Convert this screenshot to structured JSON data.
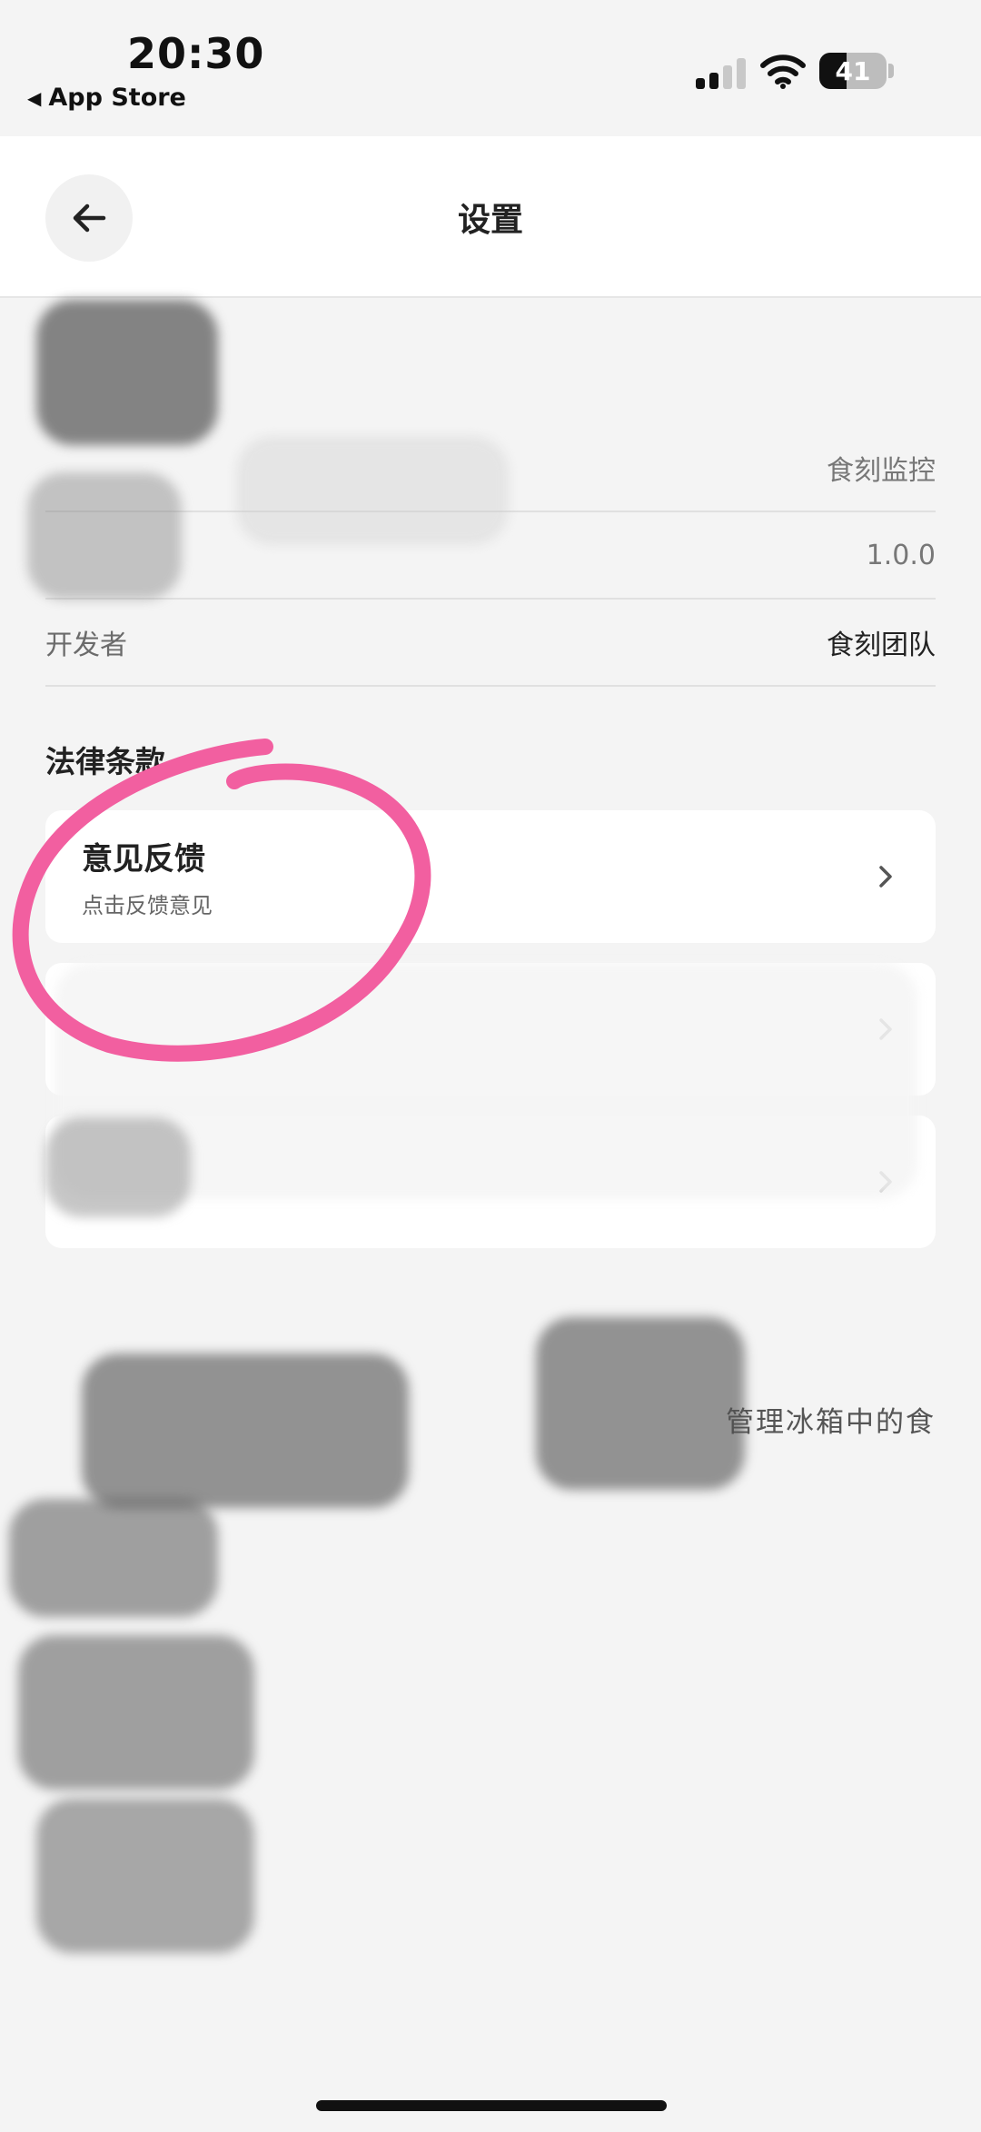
{
  "status_bar": {
    "time": "20:30",
    "back_app": "App Store",
    "battery": "41",
    "battery_level": 0.41,
    "icons": [
      "signal-icon",
      "wifi-icon",
      "battery-icon"
    ]
  },
  "header": {
    "title": "设置",
    "back_icon": "arrow-left-icon"
  },
  "info": {
    "app_name_value": "食刻监控",
    "version_value": "1.0.0",
    "developer_label": "开发者",
    "developer_value": "食刻团队"
  },
  "legal": {
    "section_label": "法律条款",
    "items": [
      {
        "title": "意见反馈",
        "subtitle": "点击反馈意见",
        "icon": "chevron-right-icon"
      }
    ]
  },
  "about": {
    "text": "管理冰箱中的食"
  },
  "colors": {
    "background": "#f4f4f4",
    "card": "#ffffff",
    "annotation": "#f25fa0"
  }
}
